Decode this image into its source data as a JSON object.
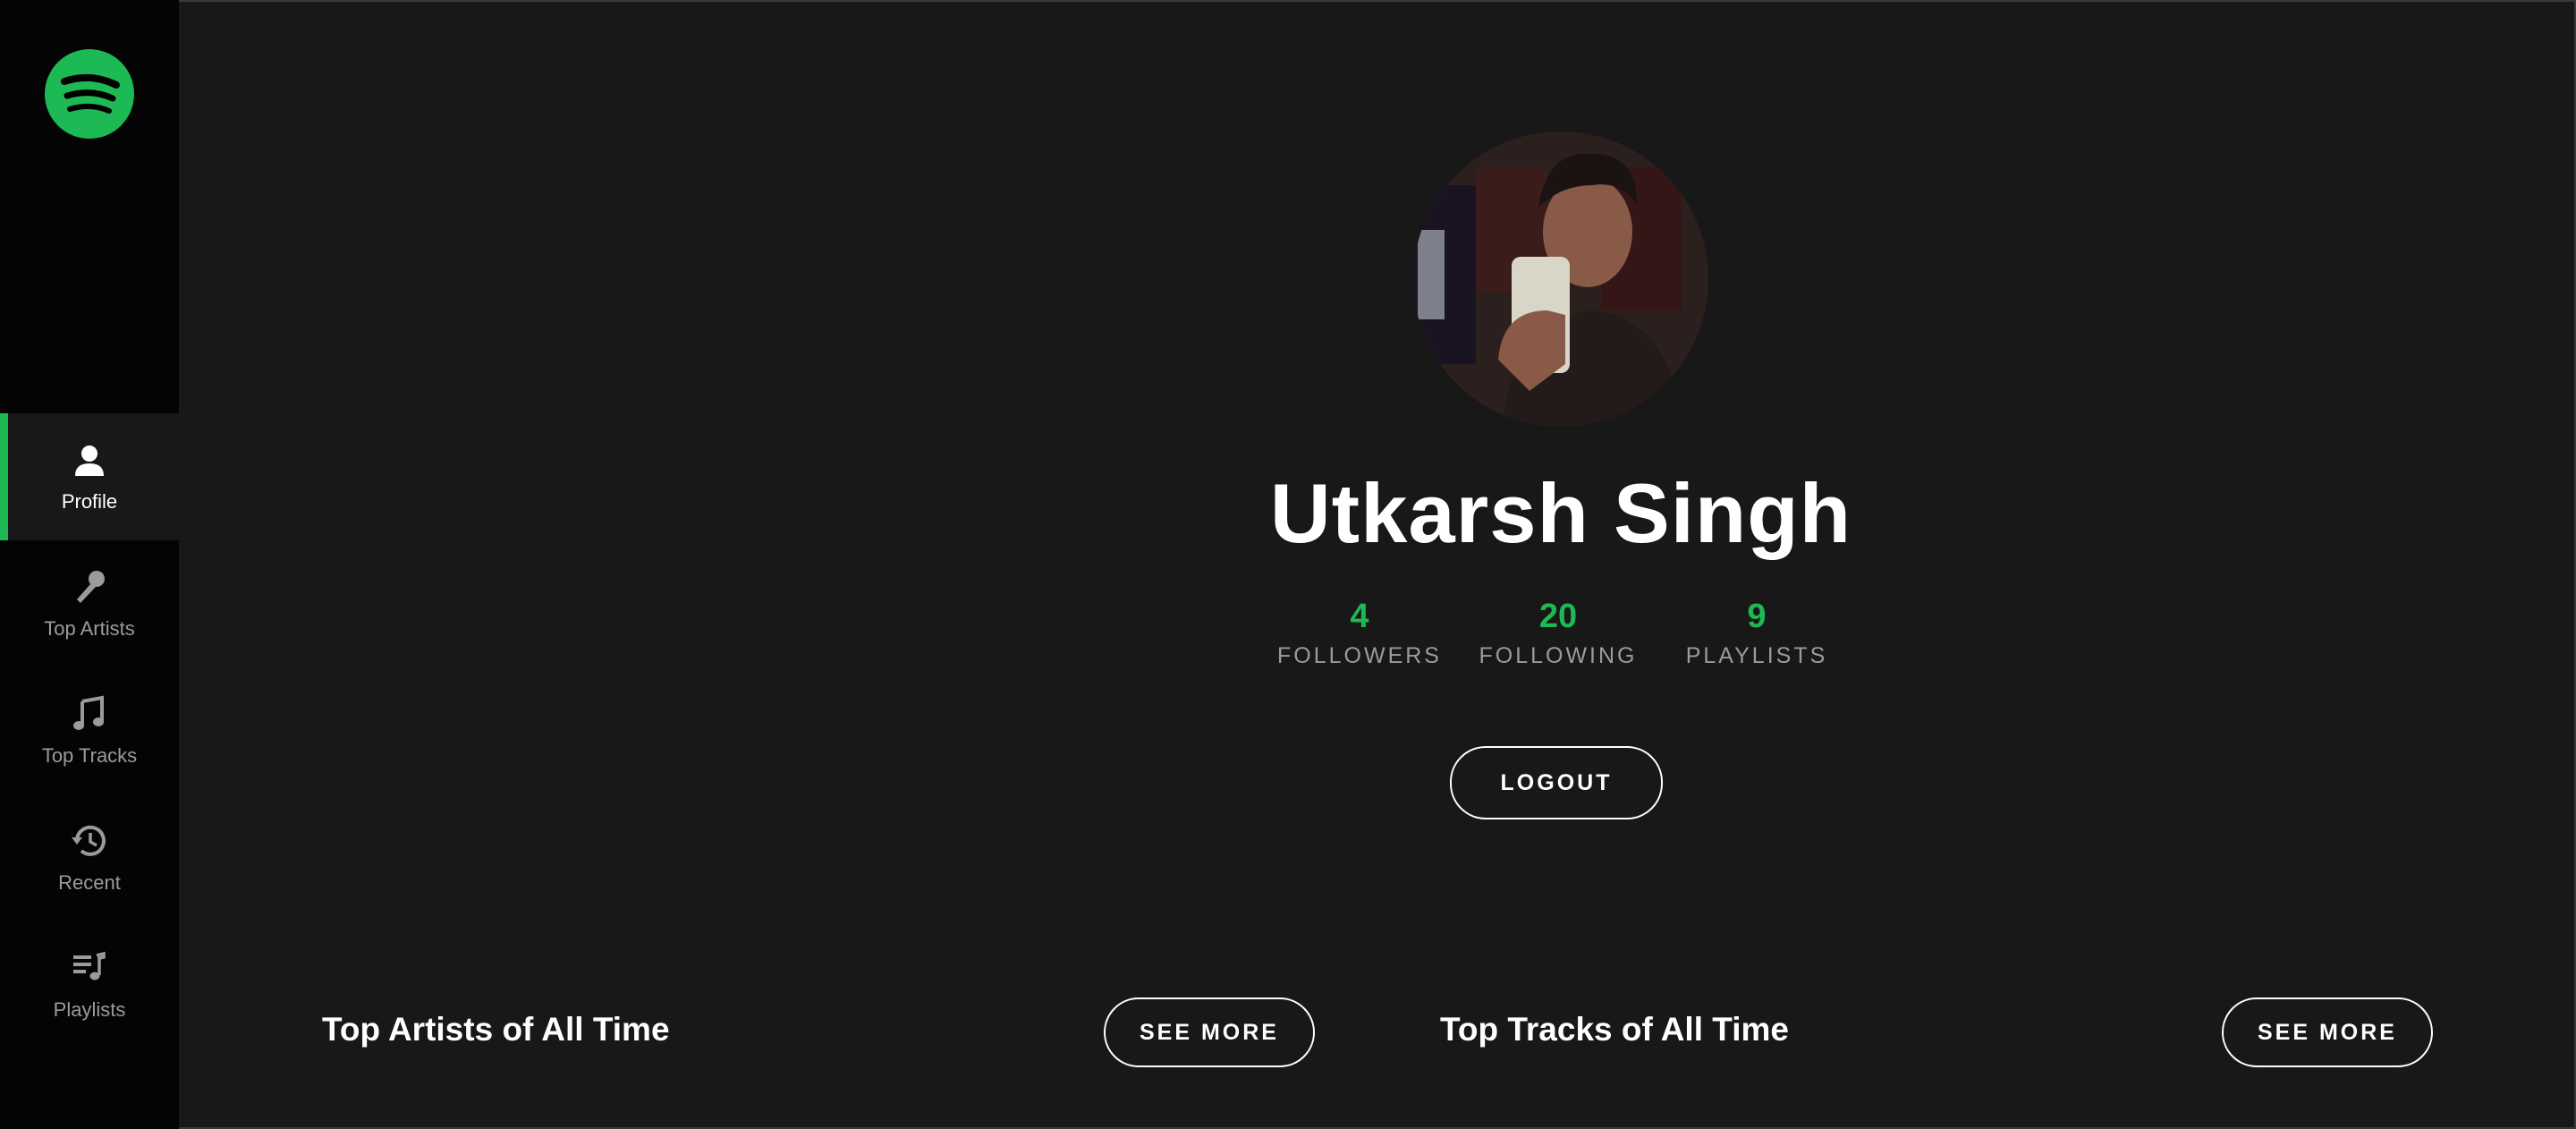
{
  "sidebar": {
    "logo_icon": "spotify-logo-icon",
    "items": [
      {
        "label": "Profile",
        "icon": "user-icon",
        "active": true
      },
      {
        "label": "Top Artists",
        "icon": "microphone-icon",
        "active": false
      },
      {
        "label": "Top Tracks",
        "icon": "music-note-icon",
        "active": false
      },
      {
        "label": "Recent",
        "icon": "history-icon",
        "active": false
      },
      {
        "label": "Playlists",
        "icon": "playlist-icon",
        "active": false
      }
    ]
  },
  "profile": {
    "name": "Utkarsh Singh",
    "avatar_icon": "profile-photo",
    "stats": [
      {
        "value": "4",
        "label": "FOLLOWERS"
      },
      {
        "value": "20",
        "label": "FOLLOWING"
      },
      {
        "value": "9",
        "label": "PLAYLISTS"
      }
    ],
    "logout_label": "LOGOUT"
  },
  "sections": {
    "top_artists": {
      "title": "Top Artists of All Time",
      "button": "SEE MORE"
    },
    "top_tracks": {
      "title": "Top Tracks of All Time",
      "button": "SEE MORE"
    }
  },
  "colors": {
    "accent": "#1db954",
    "background": "#181818",
    "sidebar": "#040404",
    "muted_text": "#9b9b9b"
  }
}
